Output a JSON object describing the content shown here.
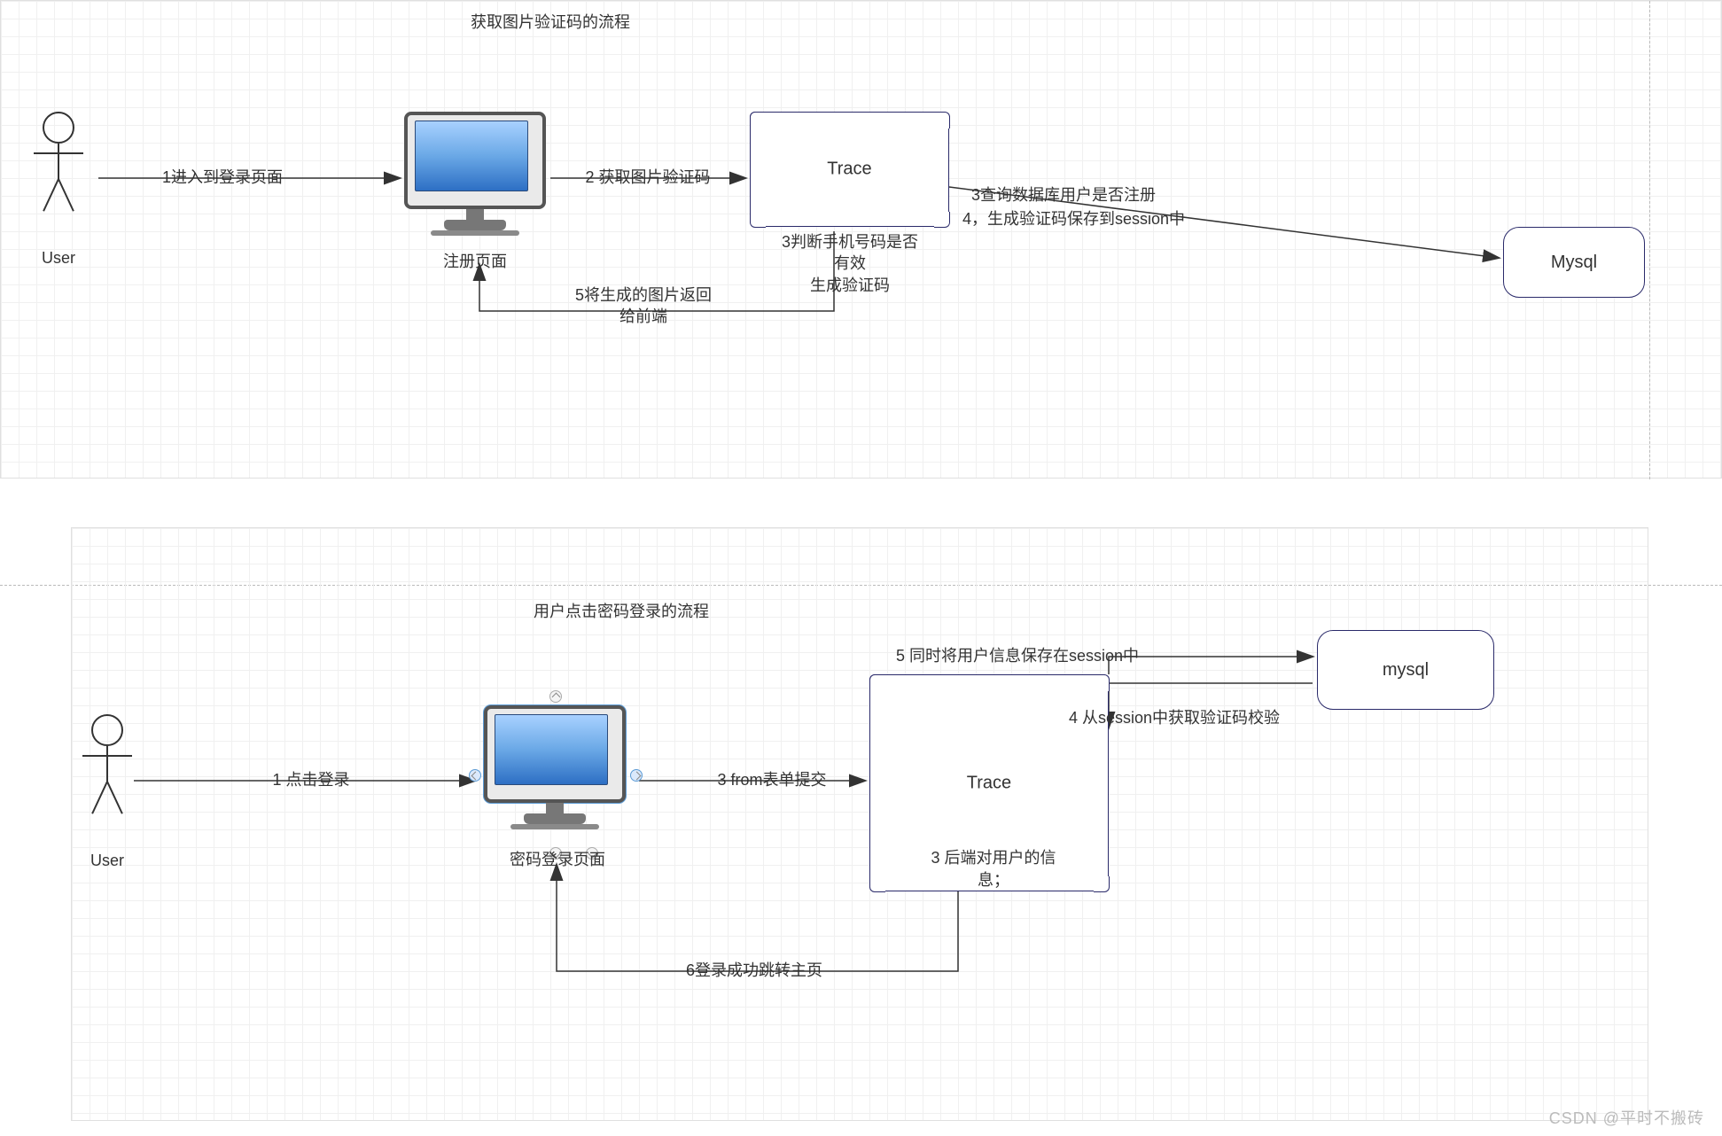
{
  "watermark": "CSDN @平时不搬砖",
  "diagram1": {
    "title": "获取图片验证码的流程",
    "user_label": "User",
    "register_page_label": "注册页面",
    "trace_label": "Trace",
    "mysql_label": "Mysql",
    "edges": {
      "e1": "1进入到登录页面",
      "e2": "2 获取图片验证码",
      "e3_line1": "3查询数据库用户是否注册",
      "e3_line2": "4，生成验证码保存到session中",
      "e3b_line1": "3判断手机号码是否",
      "e3b_line2": "有效",
      "e3b_line3": "生成验证码",
      "e5_line1": "5将生成的图片返回",
      "e5_line2": "给前端"
    }
  },
  "diagram2": {
    "title": "用户点击密码登录的流程",
    "user_label": "User",
    "login_page_label": "密码登录页面",
    "trace_label": "Trace",
    "mysql_label": "mysql",
    "edges": {
      "e1": "1 点击登录",
      "e3_submit": "3 from表单提交",
      "e3_backend_line1": "3 后端对用户的信",
      "e3_backend_line2": "息；",
      "e4": "4 从session中获取验证码校验",
      "e5": "5 同时将用户信息保存在session中",
      "e6": "6登录成功跳转主页"
    }
  }
}
